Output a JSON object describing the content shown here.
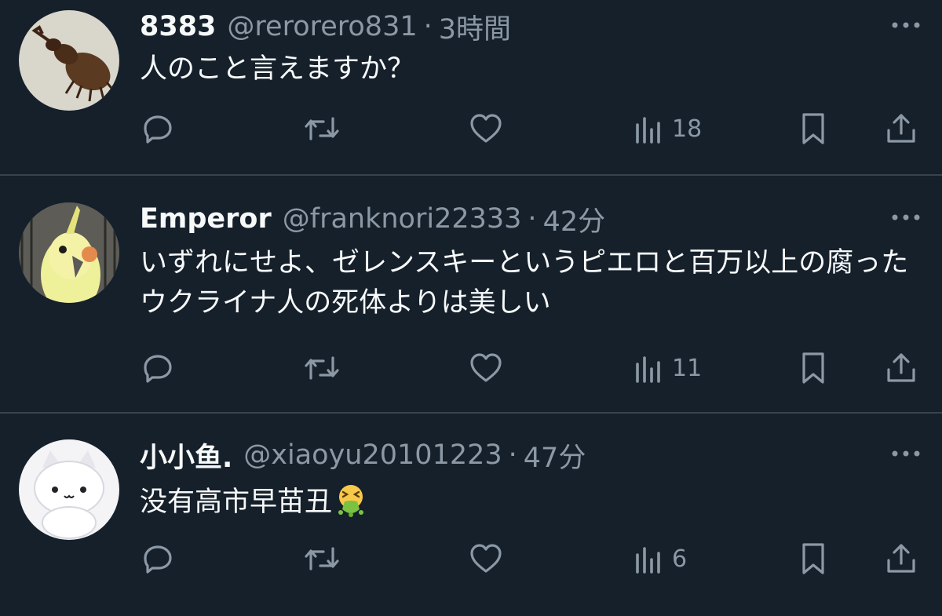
{
  "tweets": [
    {
      "name": "8383",
      "handle": "@rerorero831",
      "separator": "·",
      "time": "3時間",
      "text": "人のこと言えますか？",
      "views": "18",
      "avatar": "beetle"
    },
    {
      "name": "Emperor",
      "handle": "@franknori22333",
      "separator": "·",
      "time": "42分",
      "text": "いずれにせよ、ゼレンスキーというピエロと百万以上の腐ったウクライナ人の死体よりは美しい",
      "views": "11",
      "avatar": "cockatiel"
    },
    {
      "name": "小小鱼.",
      "handle": "@xiaoyu20101223",
      "separator": "·",
      "time": "47分",
      "text": "没有高市早苗丑",
      "text_emoji": "face-vomiting",
      "views": "6",
      "avatar": "white-cat"
    }
  ],
  "icons": {
    "reply": "reply-icon",
    "retweet": "retweet-icon",
    "like": "like-icon",
    "views": "views-icon",
    "bookmark": "bookmark-icon",
    "share": "share-icon",
    "more": "more-icon"
  },
  "colors": {
    "background": "#15202b",
    "text_primary": "#f7f9f9",
    "text_secondary": "#8b98a5",
    "divider": "#38444d"
  }
}
